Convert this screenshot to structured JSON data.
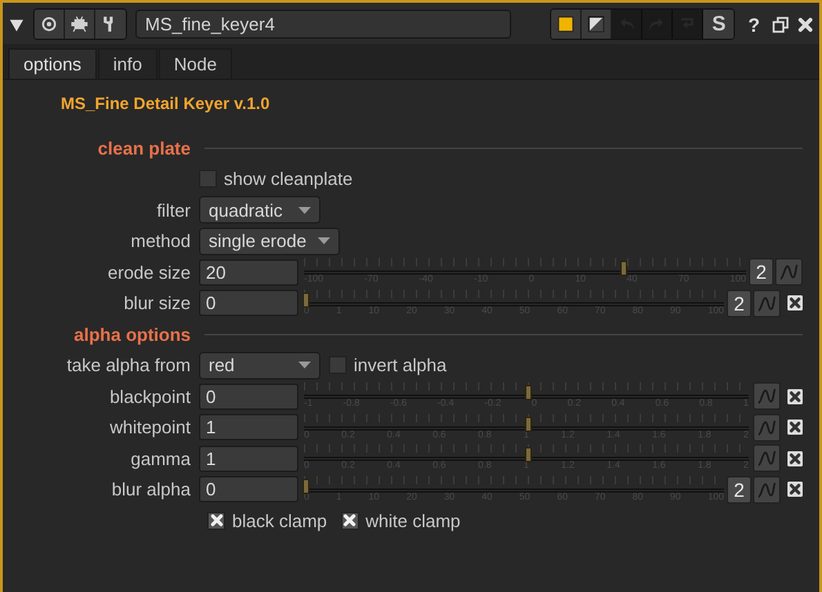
{
  "window": {
    "title": "MS_fine_keyer4",
    "help": "?"
  },
  "toolbar": [
    {
      "kind": "color",
      "disabled": false
    },
    {
      "kind": "mask",
      "disabled": false
    },
    {
      "kind": "undo",
      "disabled": true
    },
    {
      "kind": "redo",
      "disabled": true
    },
    {
      "kind": "revert",
      "disabled": true
    },
    {
      "kind": "text",
      "label": "S",
      "disabled": false
    }
  ],
  "tabs": [
    {
      "label": "options",
      "selected": true
    },
    {
      "label": "info",
      "selected": false
    },
    {
      "label": "Node",
      "selected": false
    }
  ],
  "heading": "MS_Fine Detail Keyer v.1.0",
  "rows": [
    {
      "kind": "section",
      "label": "clean plate"
    },
    {
      "kind": "checkbox",
      "label": "show cleanplate",
      "checked": false
    },
    {
      "kind": "dropdown",
      "label": "filter",
      "value": "quadratic"
    },
    {
      "kind": "dropdown",
      "label": "method",
      "value": "single erode"
    },
    {
      "kind": "slider",
      "label": "erode size",
      "value": "20",
      "level": 0.72,
      "ticks": [
        "-100",
        "-70",
        "-40",
        "-10",
        "0",
        "10",
        "40",
        "70",
        "100"
      ],
      "views": "2",
      "resettable": false
    },
    {
      "kind": "slider",
      "label": "blur size",
      "value": "0",
      "level": 0,
      "ticks": [
        "0",
        "1",
        "10",
        "20",
        "30",
        "40",
        "50",
        "60",
        "70",
        "80",
        "90",
        "100"
      ],
      "views": "2",
      "resettable": true
    },
    {
      "kind": "section",
      "label": "alpha options"
    },
    {
      "kind": "dropdown",
      "label": "take alpha from",
      "value": "red",
      "checkbox": {
        "label": "invert alpha",
        "checked": false
      }
    },
    {
      "kind": "slider",
      "label": "blackpoint",
      "value": "0",
      "level": 0.5,
      "ticks": [
        "-1",
        "-0.8",
        "-0.6",
        "-0.4",
        "-0.2",
        "0",
        "0.2",
        "0.4",
        "0.6",
        "0.8",
        "1"
      ],
      "resettable": true
    },
    {
      "kind": "slider",
      "label": "whitepoint",
      "value": "1",
      "level": 0.5,
      "ticks": [
        "0",
        "0.2",
        "0.4",
        "0.6",
        "0.8",
        "1",
        "1.2",
        "1.4",
        "1.6",
        "1.8",
        "2"
      ],
      "resettable": true
    },
    {
      "kind": "slider",
      "label": "gamma",
      "value": "1",
      "level": 0.5,
      "ticks": [
        "0",
        "0.2",
        "0.4",
        "0.6",
        "0.8",
        "1",
        "1.2",
        "1.4",
        "1.6",
        "1.8",
        "2"
      ],
      "resettable": true
    },
    {
      "kind": "slider",
      "label": "blur alpha",
      "value": "0",
      "level": 0,
      "ticks": [
        "0",
        "1",
        "10",
        "20",
        "30",
        "40",
        "50",
        "60",
        "70",
        "80",
        "90",
        "100"
      ],
      "views": "2",
      "resettable": true
    },
    {
      "kind": "checkboxes",
      "items": [
        {
          "label": "black clamp",
          "checked": true
        },
        {
          "label": "white clamp",
          "checked": true
        }
      ]
    }
  ]
}
